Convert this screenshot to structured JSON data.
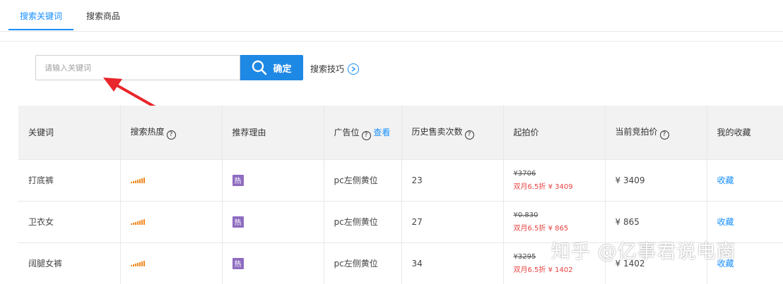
{
  "tabs": [
    {
      "label": "搜索关键词",
      "active": true
    },
    {
      "label": "搜索商品",
      "active": false
    }
  ],
  "search": {
    "placeholder": "请输入关键词",
    "button_label": "确定",
    "tips_label": "搜索技巧"
  },
  "table": {
    "headers": {
      "keyword": "关键词",
      "heat": "搜索热度",
      "reason": "推荐理由",
      "ad_slot": "广告位",
      "ad_slot_link": "查看",
      "history": "历史售卖次数",
      "start_price": "起拍价",
      "current_bid": "当前竞拍价",
      "collect": "我的收藏"
    },
    "rows": [
      {
        "keyword": "打底裤",
        "reason_tag": "热",
        "ad_slot": "pc左侧黄位",
        "history": "23",
        "price_old": "¥3706",
        "price_new": "双月6.5折 ¥ 3409",
        "current_bid": "¥ 3409",
        "collect": "收藏"
      },
      {
        "keyword": "卫衣女",
        "reason_tag": "热",
        "ad_slot": "pc左侧黄位",
        "history": "27",
        "price_old": "¥0.830",
        "price_new": "双月6.5折 ¥ 865",
        "current_bid": "¥ 865",
        "collect": "收藏"
      },
      {
        "keyword": "阔腿女裤",
        "reason_tag": "热",
        "ad_slot": "pc左侧黄位",
        "history": "34",
        "price_old": "¥3295",
        "price_new": "双月6.5折 ¥ 1402",
        "current_bid": "¥ 1402",
        "collect": "收藏"
      }
    ]
  },
  "watermark": "知乎 @亿事君说电商",
  "colors": {
    "accent": "#1890ff",
    "button": "#1e88e5",
    "price_red": "#e64340",
    "heat_orange": "#f08a24",
    "tag_purple": "#8e6cc0",
    "arrow_red": "#e8262b"
  }
}
